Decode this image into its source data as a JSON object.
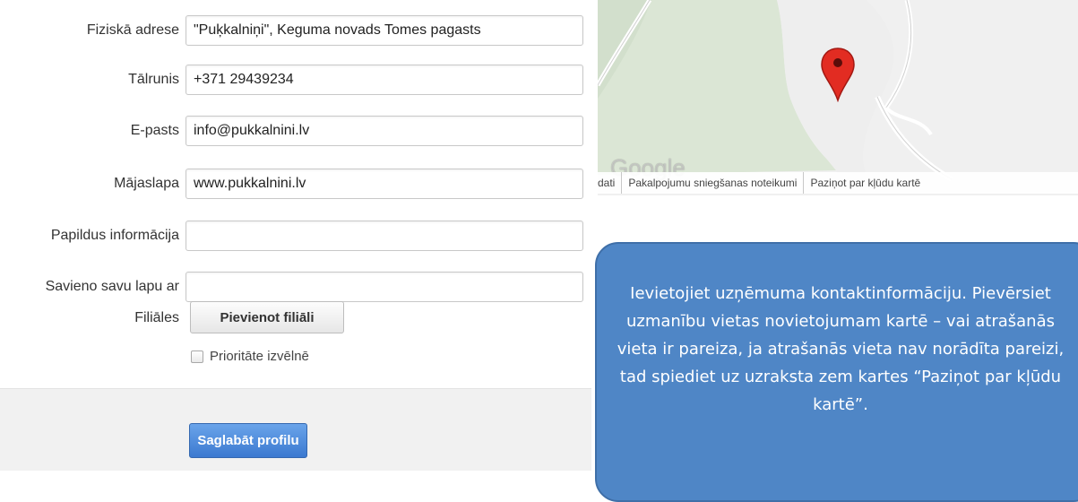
{
  "form": {
    "address": {
      "label": "Fiziskā adrese",
      "value": "\"Puķkalniņi\", Keguma novads Tomes pagasts"
    },
    "phone": {
      "label": "Tālrunis",
      "value": "+371 29439234"
    },
    "email": {
      "label": "E-pasts",
      "value": "info@pukkalnini.lv"
    },
    "website": {
      "label": "Mājaslapa",
      "value": "www.pukkalnini.lv"
    },
    "extra_info": {
      "label": "Papildus informācija",
      "value": ""
    },
    "connect": {
      "label": "Savieno savu lapu ar",
      "value": ""
    },
    "branches": {
      "label": "Filiāles",
      "button": "Pievienot filiāli"
    },
    "priority": {
      "label": "Prioritāte izvēlnē",
      "checked": false
    },
    "save_button": "Saglabāt profilu"
  },
  "map": {
    "logo": "Google",
    "footer_links": [
      "dati",
      "Pakalpojumu sniegšanas noteikumi",
      "Paziņot par kļūdu kartē"
    ],
    "pin_icon": "map-pin-icon",
    "colors": {
      "forest": "#dde7d8",
      "field": "#eeeeee",
      "road": "#ffffff",
      "pin": "#e02b20"
    }
  },
  "callout": {
    "text": "Ievietojiet uzņēmuma kontaktinformāciju. Pievērsiet uzmanību vietas novietojumam kartē – vai atrašanās vieta ir pareiza, ja atrašanās vieta nav norādīta pareizi, tad spiediet uz uzraksta zem kartes “Paziņot par kļūdu kartē”.",
    "color": "#4f86c6"
  }
}
